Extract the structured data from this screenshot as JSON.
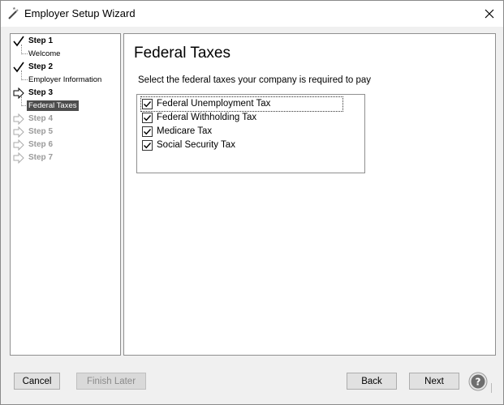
{
  "window": {
    "title": "Employer Setup Wizard",
    "close_icon": "close-icon",
    "app_icon": "wand-icon"
  },
  "steps": [
    {
      "label": "Step 1",
      "status": "done",
      "sub": "Welcome"
    },
    {
      "label": "Step 2",
      "status": "done",
      "sub": "Employer Information"
    },
    {
      "label": "Step 3",
      "status": "current",
      "sub": "Federal Taxes"
    },
    {
      "label": "Step 4",
      "status": "future"
    },
    {
      "label": "Step 5",
      "status": "future"
    },
    {
      "label": "Step 6",
      "status": "future"
    },
    {
      "label": "Step 7",
      "status": "future"
    }
  ],
  "content": {
    "title": "Federal Taxes",
    "instructions": "Select the federal taxes your company is required to pay",
    "taxes": [
      {
        "label": "Federal Unemployment Tax",
        "checked": true
      },
      {
        "label": "Federal Withholding Tax",
        "checked": true
      },
      {
        "label": "Medicare Tax",
        "checked": true
      },
      {
        "label": "Social Security Tax",
        "checked": true
      }
    ]
  },
  "buttons": {
    "cancel": "Cancel",
    "finish_later": "Finish Later",
    "back": "Back",
    "next": "Next"
  },
  "colors": {
    "selected_bg": "#4d4d4d",
    "future_text": "#9a9a9a",
    "panel_border": "#8f8f8f"
  }
}
